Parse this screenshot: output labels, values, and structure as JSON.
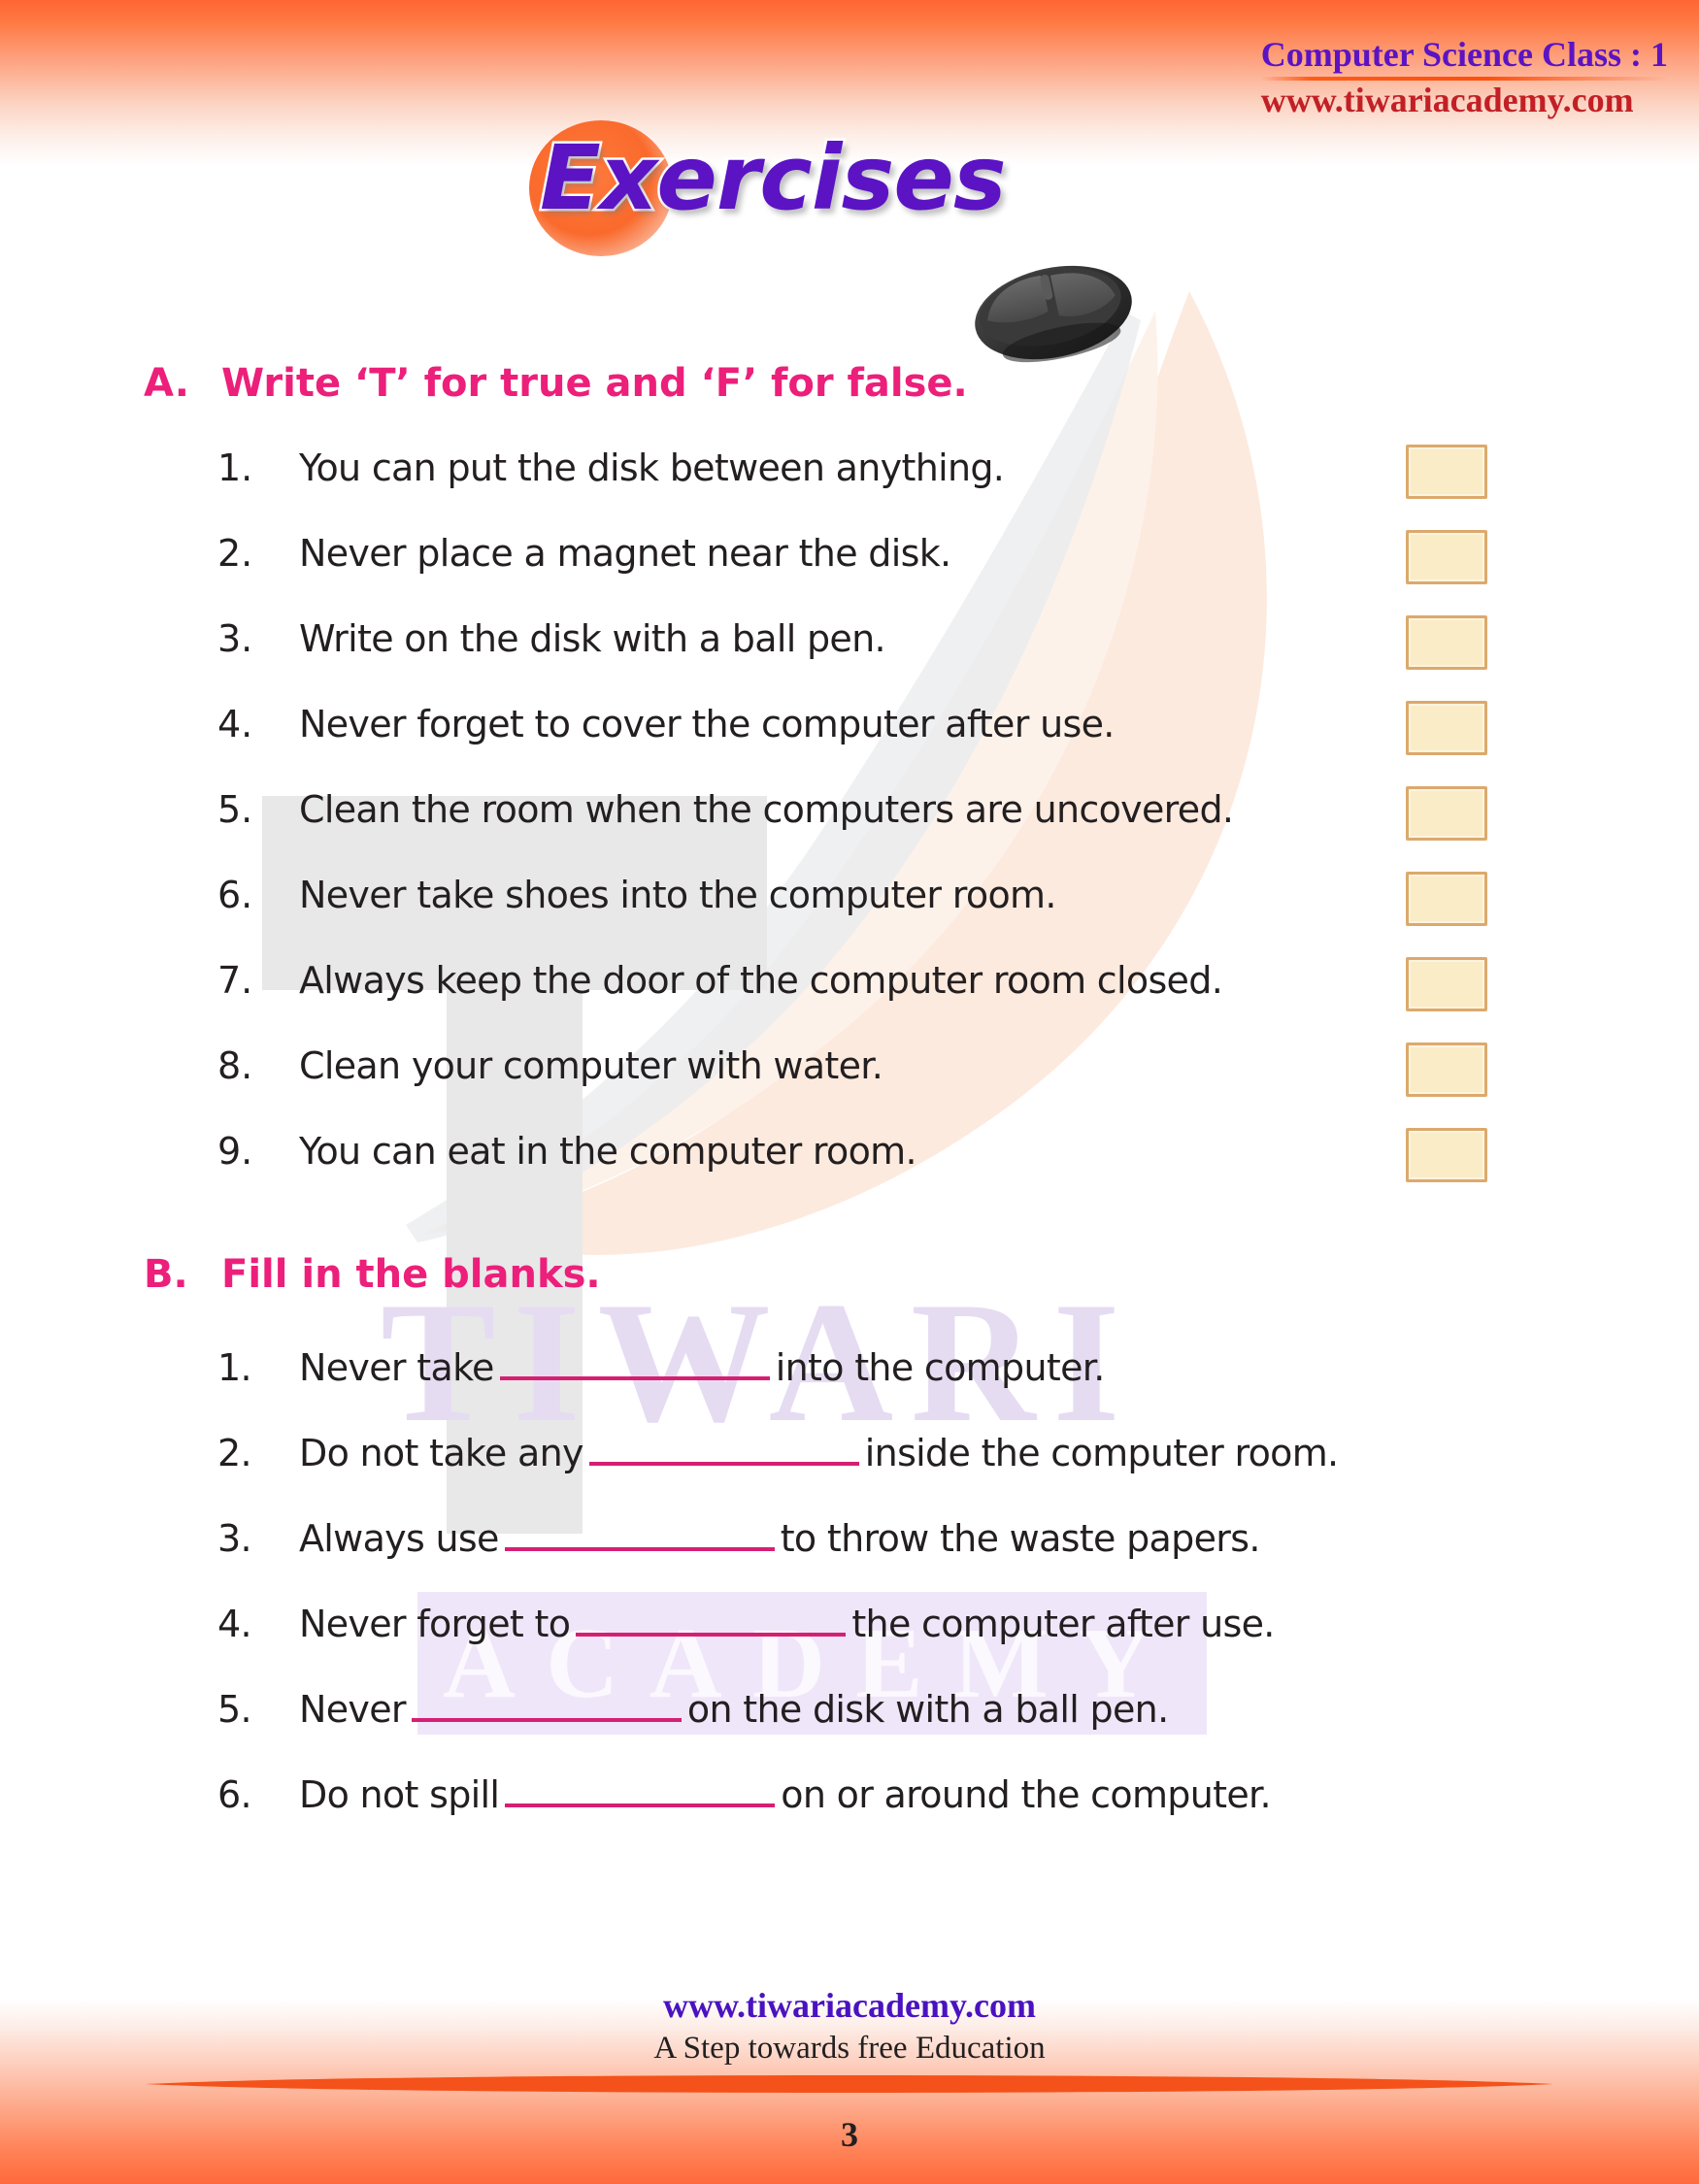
{
  "header": {
    "course_title": "Computer Science Class : 1",
    "site_url": "www.tiwariacademy.com"
  },
  "title": {
    "heading": "Exercises",
    "icon": "computer-mouse-icon"
  },
  "watermark": {
    "line1": "TIWARI",
    "line2": "ACADEMY"
  },
  "sections": [
    {
      "letter": "A.",
      "heading": "Write ‘T’ for true and ‘F’ for false.",
      "items": [
        {
          "num": "1.",
          "text": "You can put the disk between anything."
        },
        {
          "num": "2.",
          "text": "Never place a magnet near the disk."
        },
        {
          "num": "3.",
          "text": "Write on the disk with a ball pen."
        },
        {
          "num": "4.",
          "text": "Never forget to cover the computer after use."
        },
        {
          "num": "5.",
          "text": "Clean the room when the computers are uncovered."
        },
        {
          "num": "6.",
          "text": "Never take shoes into the computer room."
        },
        {
          "num": "7.",
          "text": "Always keep the door of the computer room closed."
        },
        {
          "num": "8.",
          "text": "Clean your computer with water."
        },
        {
          "num": "9.",
          "text": "You can eat in the computer room."
        }
      ]
    },
    {
      "letter": "B.",
      "heading": "Fill in the blanks.",
      "items": [
        {
          "num": "1.",
          "before": "Never take",
          "after": "into the computer."
        },
        {
          "num": "2.",
          "before": "Do not take any",
          "after": "inside the computer room."
        },
        {
          "num": "3.",
          "before": "Always use",
          "after": "to throw the waste papers."
        },
        {
          "num": "4.",
          "before": "Never forget to",
          "after": "the computer after use."
        },
        {
          "num": "5.",
          "before": "Never",
          "after": "on the disk with a ball pen."
        },
        {
          "num": "6.",
          "before": "Do not spill",
          "after": "on or around the computer."
        }
      ]
    }
  ],
  "footer": {
    "url": "www.tiwariacademy.com",
    "tagline": "A Step towards free Education",
    "page_number": "3"
  },
  "colors": {
    "brand_orange": "#ff6633",
    "heading_pink": "#ec1f7a",
    "title_purple": "#5b13c4",
    "header_url_red": "#c22026",
    "footer_url_purple": "#4a12c0",
    "answer_box_fill": "#fbecc8",
    "answer_box_border": "#dca96c",
    "blank_rule": "#d61f73"
  }
}
